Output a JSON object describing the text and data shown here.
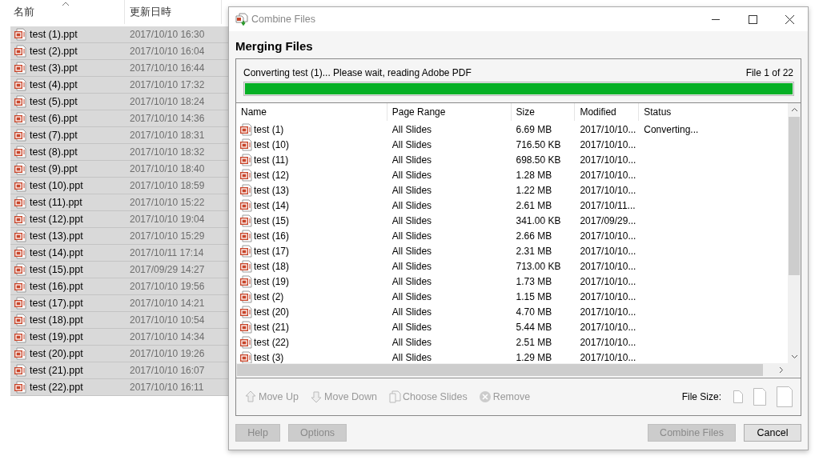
{
  "explorer": {
    "columns": [
      "名前",
      "更新日時"
    ],
    "rows": [
      {
        "name": "test (1).ppt",
        "modified": "2017/10/10 16:30",
        "selected": true
      },
      {
        "name": "test (2).ppt",
        "modified": "2017/10/10 16:04",
        "selected": true
      },
      {
        "name": "test (3).ppt",
        "modified": "2017/10/10 16:44",
        "selected": true
      },
      {
        "name": "test (4).ppt",
        "modified": "2017/10/10 17:32",
        "selected": true
      },
      {
        "name": "test (5).ppt",
        "modified": "2017/10/10 18:24",
        "selected": true
      },
      {
        "name": "test (6).ppt",
        "modified": "2017/10/10 14:36",
        "selected": true
      },
      {
        "name": "test (7).ppt",
        "modified": "2017/10/10 18:31",
        "selected": true
      },
      {
        "name": "test (8).ppt",
        "modified": "2017/10/10 18:32",
        "selected": true
      },
      {
        "name": "test (9).ppt",
        "modified": "2017/10/10 18:40",
        "selected": true
      },
      {
        "name": "test (10).ppt",
        "modified": "2017/10/10 18:59",
        "selected": true
      },
      {
        "name": "test (11).ppt",
        "modified": "2017/10/10 15:22",
        "selected": true
      },
      {
        "name": "test (12).ppt",
        "modified": "2017/10/10 19:04",
        "selected": true
      },
      {
        "name": "test (13).ppt",
        "modified": "2017/10/10 15:29",
        "selected": true
      },
      {
        "name": "test (14).ppt",
        "modified": "2017/10/11 17:14",
        "selected": true
      },
      {
        "name": "test (15).ppt",
        "modified": "2017/09/29 14:27",
        "selected": true
      },
      {
        "name": "test (16).ppt",
        "modified": "2017/10/10 19:56",
        "selected": true
      },
      {
        "name": "test (17).ppt",
        "modified": "2017/10/10 14:21",
        "selected": true
      },
      {
        "name": "test (18).ppt",
        "modified": "2017/10/10 10:54",
        "selected": true
      },
      {
        "name": "test (19).ppt",
        "modified": "2017/10/10 14:34",
        "selected": true
      },
      {
        "name": "test (20).ppt",
        "modified": "2017/10/10 19:26",
        "selected": true
      },
      {
        "name": "test (21).ppt",
        "modified": "2017/10/10 16:07",
        "selected": true
      },
      {
        "name": "test (22).ppt",
        "modified": "2017/10/10 16:11",
        "selected": true
      }
    ]
  },
  "dialog": {
    "title": "Combine Files",
    "heading": "Merging Files",
    "progress": {
      "message": "Converting test (1)... Please wait, reading Adobe PDF",
      "counter": "File 1 of 22",
      "level": 1
    },
    "table": {
      "columns": [
        "Name",
        "Page Range",
        "Size",
        "Modified",
        "Status"
      ],
      "rows": [
        {
          "name": "test (1)",
          "page_range": "All Slides",
          "size": "6.69 MB",
          "modified": "2017/10/10...",
          "status": "Converting..."
        },
        {
          "name": "test (10)",
          "page_range": "All Slides",
          "size": "716.50 KB",
          "modified": "2017/10/10..."
        },
        {
          "name": "test (11)",
          "page_range": "All Slides",
          "size": "698.50 KB",
          "modified": "2017/10/10..."
        },
        {
          "name": "test (12)",
          "page_range": "All Slides",
          "size": "1.28 MB",
          "modified": "2017/10/10..."
        },
        {
          "name": "test (13)",
          "page_range": "All Slides",
          "size": "1.22 MB",
          "modified": "2017/10/10..."
        },
        {
          "name": "test (14)",
          "page_range": "All Slides",
          "size": "2.61 MB",
          "modified": "2017/10/11..."
        },
        {
          "name": "test (15)",
          "page_range": "All Slides",
          "size": "341.00 KB",
          "modified": "2017/09/29..."
        },
        {
          "name": "test (16)",
          "page_range": "All Slides",
          "size": "2.66 MB",
          "modified": "2017/10/10..."
        },
        {
          "name": "test (17)",
          "page_range": "All Slides",
          "size": "2.31 MB",
          "modified": "2017/10/10..."
        },
        {
          "name": "test (18)",
          "page_range": "All Slides",
          "size": "713.00 KB",
          "modified": "2017/10/10..."
        },
        {
          "name": "test (19)",
          "page_range": "All Slides",
          "size": "1.73 MB",
          "modified": "2017/10/10..."
        },
        {
          "name": "test (2)",
          "page_range": "All Slides",
          "size": "1.15 MB",
          "modified": "2017/10/10..."
        },
        {
          "name": "test (20)",
          "page_range": "All Slides",
          "size": "4.70 MB",
          "modified": "2017/10/10..."
        },
        {
          "name": "test (21)",
          "page_range": "All Slides",
          "size": "5.44 MB",
          "modified": "2017/10/10..."
        },
        {
          "name": "test (22)",
          "page_range": "All Slides",
          "size": "2.51 MB",
          "modified": "2017/10/10..."
        },
        {
          "name": "test (3)",
          "page_range": "All Slides",
          "size": "1.29 MB",
          "modified": "2017/10/10..."
        }
      ]
    },
    "toolbar": [
      {
        "label": "Move Up",
        "kind": "up",
        "disabled": true
      },
      {
        "label": "Move Down",
        "kind": "down",
        "disabled": true
      },
      {
        "label": "Choose Slides",
        "kind": "slides",
        "disabled": true
      },
      {
        "label": "Remove",
        "kind": "remove",
        "disabled": true
      }
    ],
    "file_size_label": "File Size:",
    "left_buttons": [
      {
        "label": "Help",
        "disabled": true
      },
      {
        "label": "Options",
        "disabled": true
      }
    ],
    "right_buttons": [
      {
        "label": "Combine Files",
        "disabled": true
      },
      {
        "label": "Cancel",
        "disabled": false
      }
    ]
  }
}
